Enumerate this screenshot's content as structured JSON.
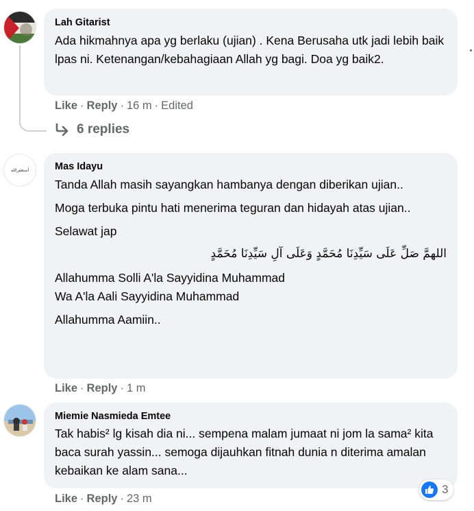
{
  "comments": [
    {
      "author": "Lah Gitarist",
      "text": "Ada hikmahnya apa yg berlaku (ujian) . Kena Berusaha utk jadi lebih baik lpas ni. Ketenangan/kebahagiaan Allah yg bagi. Doa yg baik2.",
      "like": "Like",
      "reply": "Reply",
      "time": "16 m",
      "edited": "Edited",
      "replies_link": "6 replies"
    },
    {
      "author": "Mas Idayu",
      "avatar_text": "أستغفرالله",
      "paragraphs": [
        "Tanda Allah masih sayangkan hambanya dengan diberikan ujian..",
        "Moga terbuka pintu hati menerima teguran dan hidayah atas ujian..",
        "Selawat jap"
      ],
      "arabic": "اللهمَّ صَلِّ عَلَى سَيِّدِنَا مُحَمَّدٍ وَعَلَى آلِ سَيِّدِنَا مُحَمَّدٍ",
      "latin_lines": [
        "Allahumma Solli A'la Sayyidina Muhammad",
        "Wa A'la Aali Sayyidina Muhammad"
      ],
      "closing": "Allahumma Aamiin..",
      "like": "Like",
      "reply": "Reply",
      "time": "1 m"
    },
    {
      "author": "Miemie Nasmieda Emtee",
      "text": "Tak habis² lg kisah dia ni... sempena malam jumaat ni jom la sama² kita baca surah yassin... semoga dijauhkan fitnah dunia n diterima amalan kebaikan ke alam sana...",
      "like": "Like",
      "reply": "Reply",
      "time": "23 m",
      "reaction_count": "3"
    }
  ],
  "separator": "·",
  "icons": {
    "reply_arrow": "reply-arrow-icon",
    "like_reaction": "thumbs-up-icon"
  },
  "colors": {
    "bubble": "#f0f2f5",
    "secondary_text": "#65676b",
    "like_blue": "#1877f2"
  }
}
